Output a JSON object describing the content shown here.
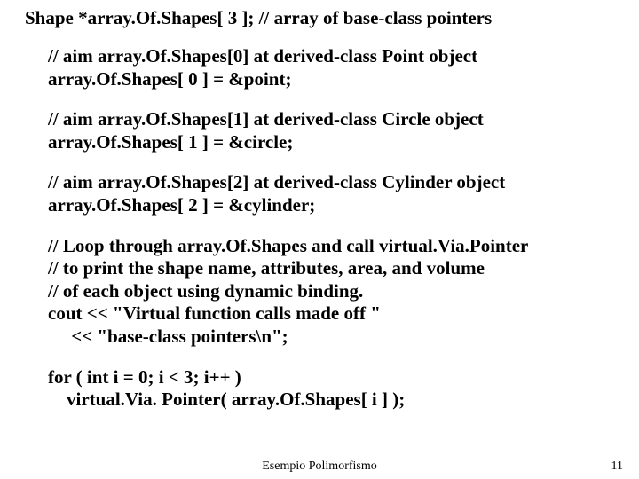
{
  "line0": "Shape *array.Of.Shapes[ 3 ];  // array of base-class pointers",
  "block1": {
    "l1": "// aim array.Of.Shapes[0] at derived-class Point object",
    "l2": "array.Of.Shapes[ 0 ] = &point;"
  },
  "block2": {
    "l1": "// aim array.Of.Shapes[1] at derived-class Circle object",
    "l2": "array.Of.Shapes[ 1 ] = &circle;"
  },
  "block3": {
    "l1": "// aim array.Of.Shapes[2] at derived-class Cylinder object",
    "l2": "array.Of.Shapes[ 2 ] = &cylinder;"
  },
  "block4": {
    "l1": "// Loop through array.Of.Shapes and call virtual.Via.Pointer",
    "l2": "// to print the shape name, attributes, area, and volume",
    "l3": "// of each object using dynamic binding.",
    "l4": "cout << \"Virtual function calls made off \"",
    "l5": "     << \"base-class pointers\\n\";"
  },
  "block5": {
    "l1": "for ( int i = 0; i < 3; i++ )",
    "l2": "    virtual.Via. Pointer( array.Of.Shapes[ i ] );"
  },
  "footer_center": "Esempio Polimorfismo",
  "footer_right": "11"
}
